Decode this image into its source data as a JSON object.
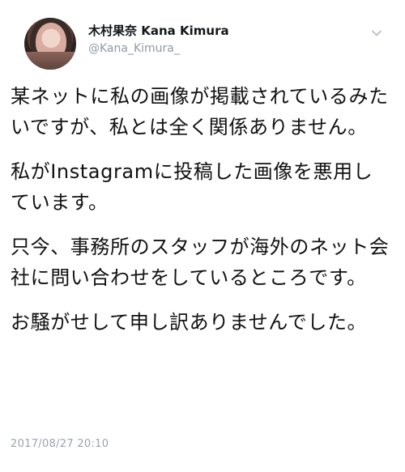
{
  "tweet": {
    "author": {
      "display_name": "木村果奈 Kana Kimura",
      "handle": "@Kana_Kimura_",
      "avatar_icon": "profile-photo"
    },
    "menu_icon": "chevron-down-icon",
    "paragraphs": [
      "某ネットに私の画像が掲載されているみたいですが、私とは全く関係ありません。",
      "私がInstagramに投稿した画像を悪用しています。",
      "只今、事務所のスタッフが海外のネット会社に問い合わせをしているところです。",
      "お騒がせして申し訳ありませんでした。"
    ],
    "timestamp": "2017/08/27 20:10"
  },
  "colors": {
    "background": "#ffffff",
    "text": "#111111",
    "secondary_text": "#8f98a2",
    "timestamp": "#9aa3ad"
  }
}
